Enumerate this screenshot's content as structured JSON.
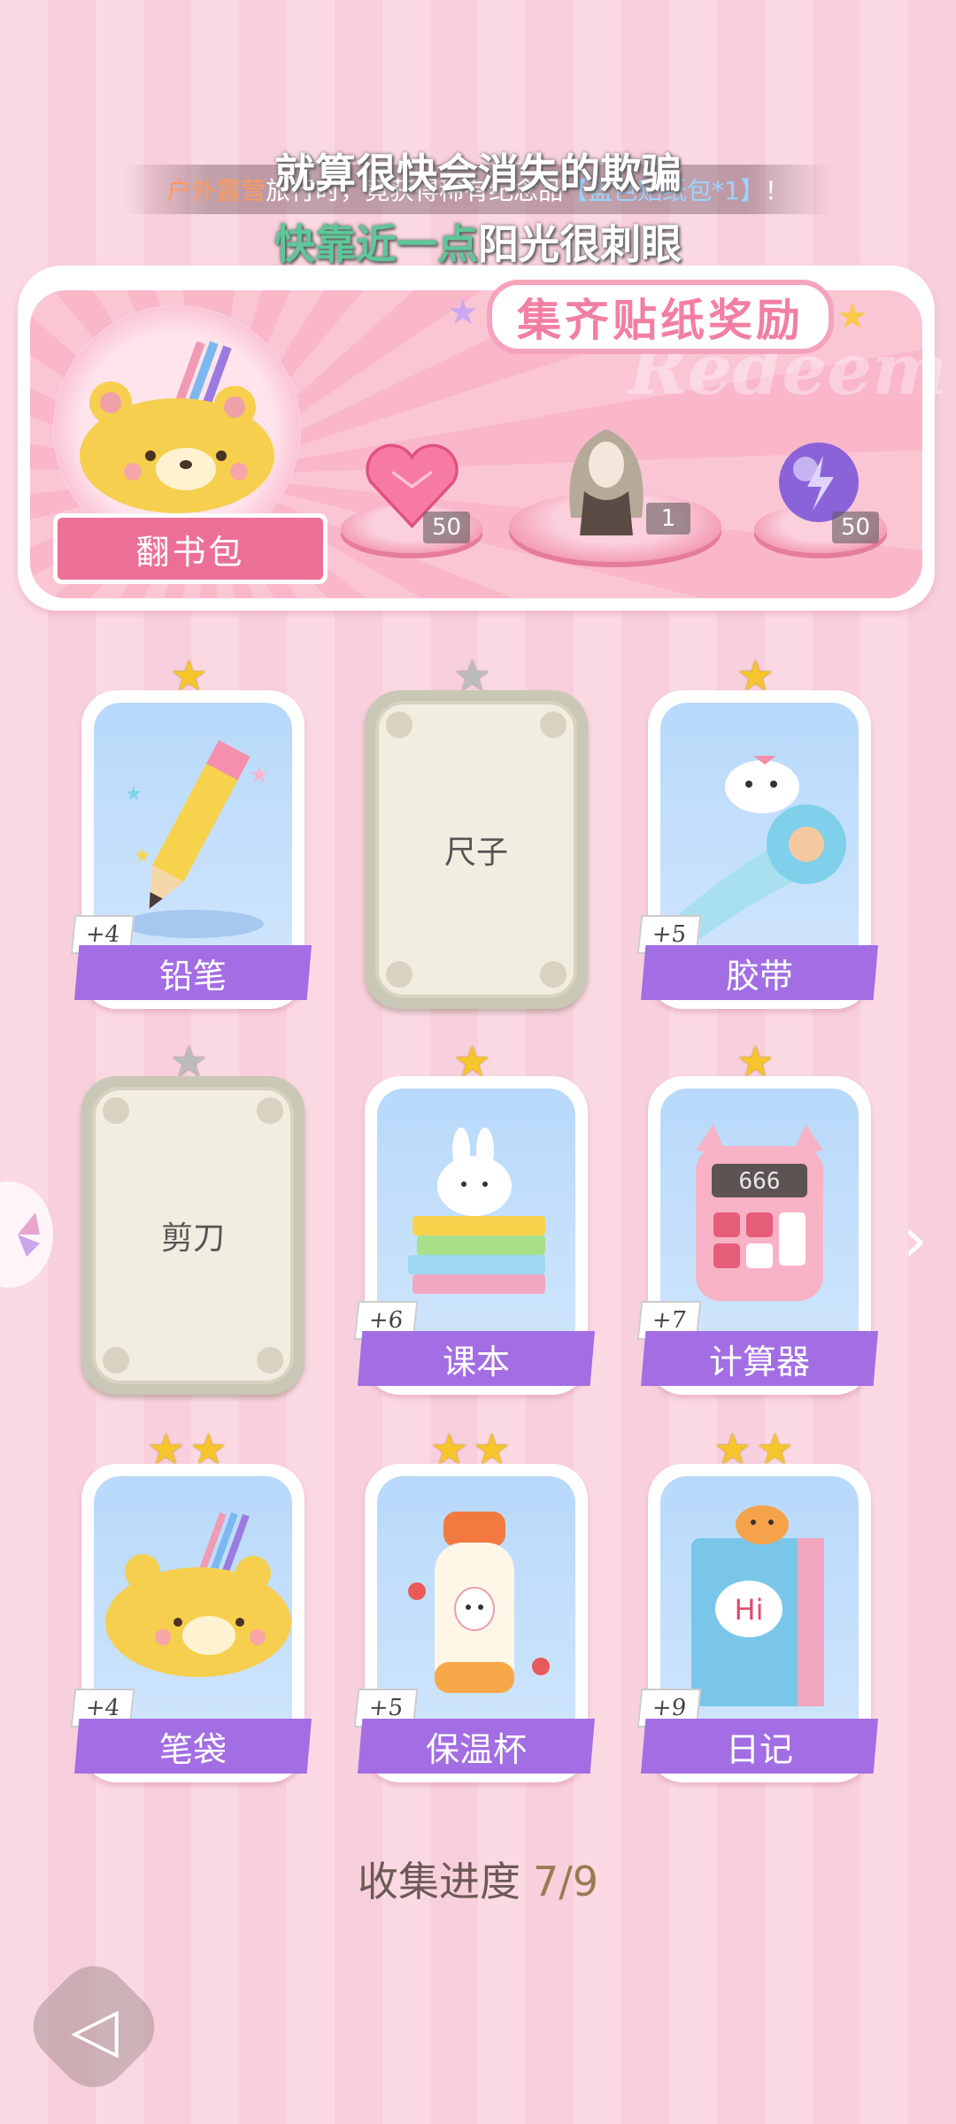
{
  "lyrics": {
    "line1": "就算很快会消失的欺骗",
    "line2_highlight": "快靠近一点",
    "line2_rest": "阳光很刺眼"
  },
  "notice": {
    "place": "户外露营",
    "middle": "旅行时，竟获得稀有纪念品",
    "item": "【蓝色贴纸包*1】",
    "end": "！"
  },
  "banner": {
    "title": "集齐贴纸奖励",
    "watermark": "Redeem",
    "bag_label": "翻书包",
    "rewards": [
      {
        "icon": "pink-heart-gem-icon",
        "count": "50"
      },
      {
        "icon": "doll-outfit-icon",
        "count": "1"
      },
      {
        "icon": "purple-energy-orb-icon",
        "count": "50"
      }
    ]
  },
  "cards": [
    {
      "name": "铅笔",
      "plus": "+4",
      "stars": 1,
      "unlocked": true,
      "icon": "pencil-icon"
    },
    {
      "name": "尺子",
      "plus": "",
      "stars": 1,
      "unlocked": false,
      "icon": ""
    },
    {
      "name": "胶带",
      "plus": "+5",
      "stars": 1,
      "unlocked": true,
      "icon": "tape-roll-icon"
    },
    {
      "name": "剪刀",
      "plus": "",
      "stars": 1,
      "unlocked": false,
      "icon": ""
    },
    {
      "name": "课本",
      "plus": "+6",
      "stars": 1,
      "unlocked": true,
      "icon": "textbook-stack-icon"
    },
    {
      "name": "计算器",
      "plus": "+7",
      "stars": 1,
      "unlocked": true,
      "icon": "calculator-icon",
      "display": "666"
    },
    {
      "name": "笔袋",
      "plus": "+4",
      "stars": 2,
      "unlocked": true,
      "icon": "pencil-case-icon"
    },
    {
      "name": "保温杯",
      "plus": "+5",
      "stars": 2,
      "unlocked": true,
      "icon": "thermos-icon"
    },
    {
      "name": "日记",
      "plus": "+9",
      "stars": 2,
      "unlocked": true,
      "icon": "diary-icon",
      "cover_text": "Hi"
    }
  ],
  "progress": {
    "label": "收集进度",
    "value": "7/9"
  },
  "colors": {
    "ribbon": "#a36ee3",
    "accent_pink": "#f27fa1",
    "star_gold": "#f5c52b"
  }
}
